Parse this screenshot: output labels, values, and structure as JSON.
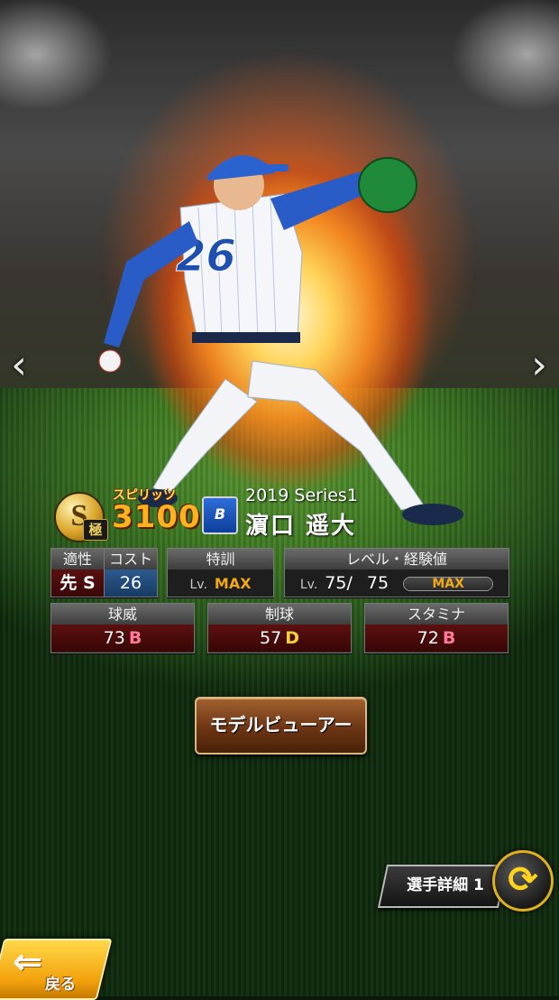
{
  "navigation": {
    "prev_glyph": "‹",
    "next_glyph": "›"
  },
  "player": {
    "rank_letter": "S",
    "rank_sub": "極",
    "spirits_label": "スピリッツ",
    "spirits_value": "3100",
    "team_logo_text": "B",
    "series": "2019 Series1",
    "name": "濵口 遥大"
  },
  "stats": {
    "aptitude": {
      "label": "適性",
      "value": "先 S"
    },
    "cost": {
      "label": "コスト",
      "value": "26"
    },
    "training": {
      "label": "特訓",
      "lv_prefix": "Lv.",
      "value": "MAX"
    },
    "level": {
      "label": "レベル・経験値",
      "lv_prefix": "Lv.",
      "current": "75/",
      "max": "75",
      "exp_label": "MAX",
      "exp_fill": 1.0
    }
  },
  "abilities": [
    {
      "label": "球威",
      "value": "73",
      "grade": "B"
    },
    {
      "label": "制球",
      "value": "57",
      "grade": "D"
    },
    {
      "label": "スタミナ",
      "value": "72",
      "grade": "B"
    }
  ],
  "buttons": {
    "model_viewer": "モデルビューアー",
    "player_detail": "選手詳細 1",
    "back": "戻る",
    "back_arrow": "⇐",
    "switch_glyph": "⟳"
  },
  "colors": {
    "grade_b": "#ff7a9a",
    "grade_d": "#f6d23a",
    "max_orange": "#f2a818",
    "spirits_orange": "#ffb21e"
  }
}
